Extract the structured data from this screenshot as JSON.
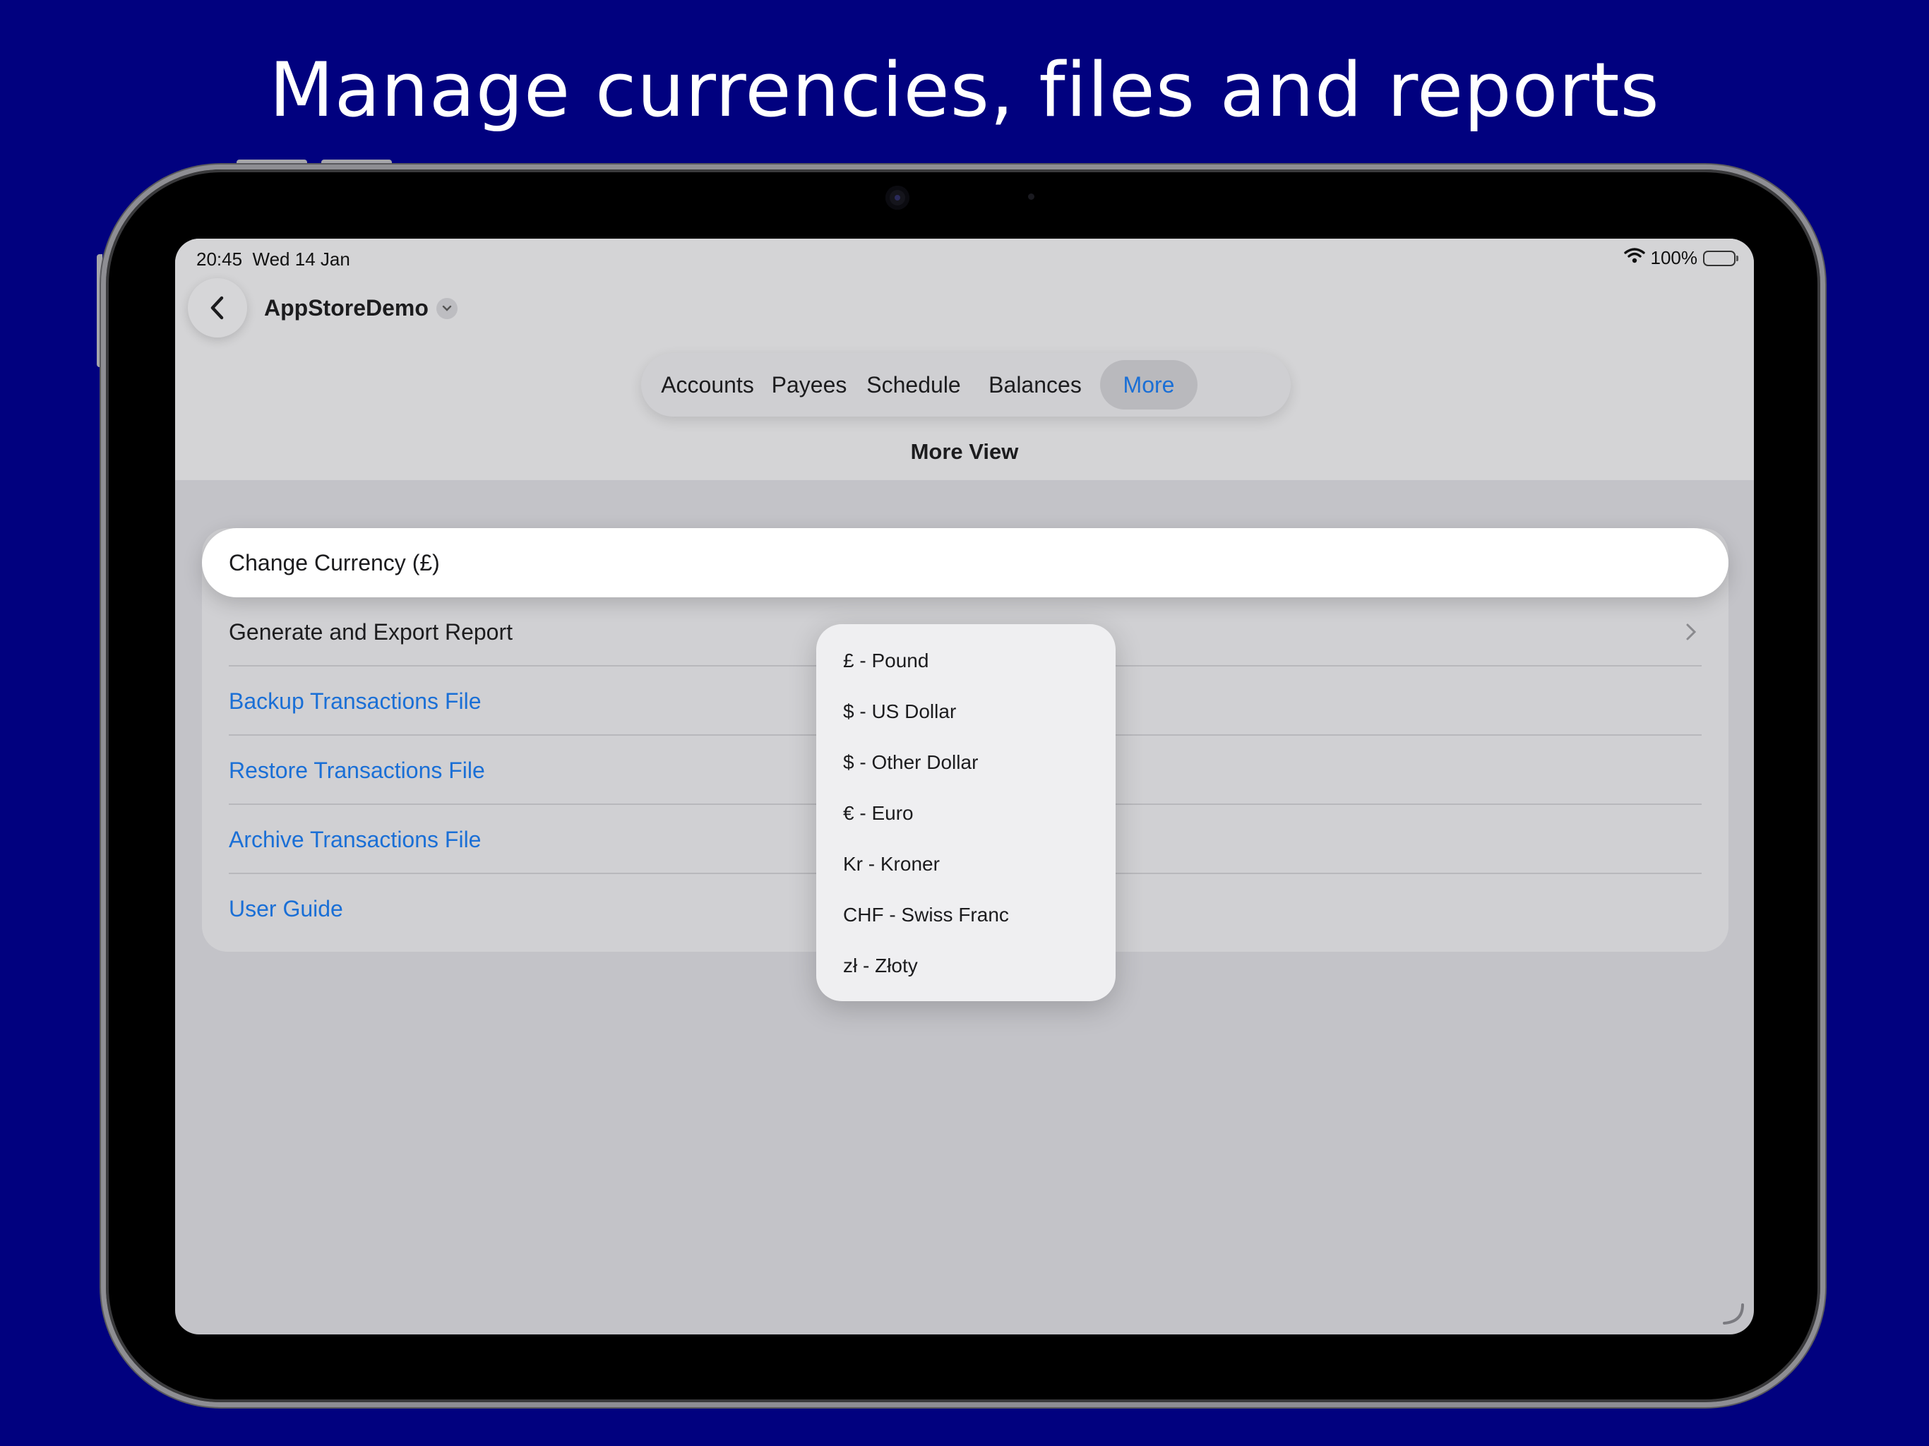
{
  "headline": "Manage currencies, files and reports",
  "status_bar": {
    "time": "20:45",
    "date": "Wed 14 Jan",
    "battery_percent": "100%",
    "battery_level": 1.0
  },
  "nav": {
    "document_title": "AppStoreDemo"
  },
  "tabs": [
    {
      "label": "Accounts",
      "active": false
    },
    {
      "label": "Payees",
      "active": false
    },
    {
      "label": "Schedule",
      "active": false
    },
    {
      "label": "Balances",
      "active": false
    },
    {
      "label": "More",
      "active": true
    }
  ],
  "page_title": "More View",
  "list": {
    "change_currency": "Change Currency (£)",
    "generate_report": "Generate and Export Report",
    "backup": "Backup Transactions File",
    "restore": "Restore Transactions File",
    "archive": "Archive Transactions File",
    "user_guide": "User Guide"
  },
  "currency_menu": [
    "£ - Pound",
    "$ - US Dollar",
    "$ - Other Dollar",
    "€ - Euro",
    "Kr - Kroner",
    "CHF - Swiss Franc",
    "zł - Złoty"
  ],
  "colors": {
    "background": "#01017f",
    "accent": "#1a6fd6",
    "screen": "#c3c3c8"
  },
  "icons": [
    "back-chevron-icon",
    "chevron-down-icon",
    "wifi-icon",
    "battery-icon",
    "chevron-right-icon",
    "resize-handle-icon"
  ]
}
